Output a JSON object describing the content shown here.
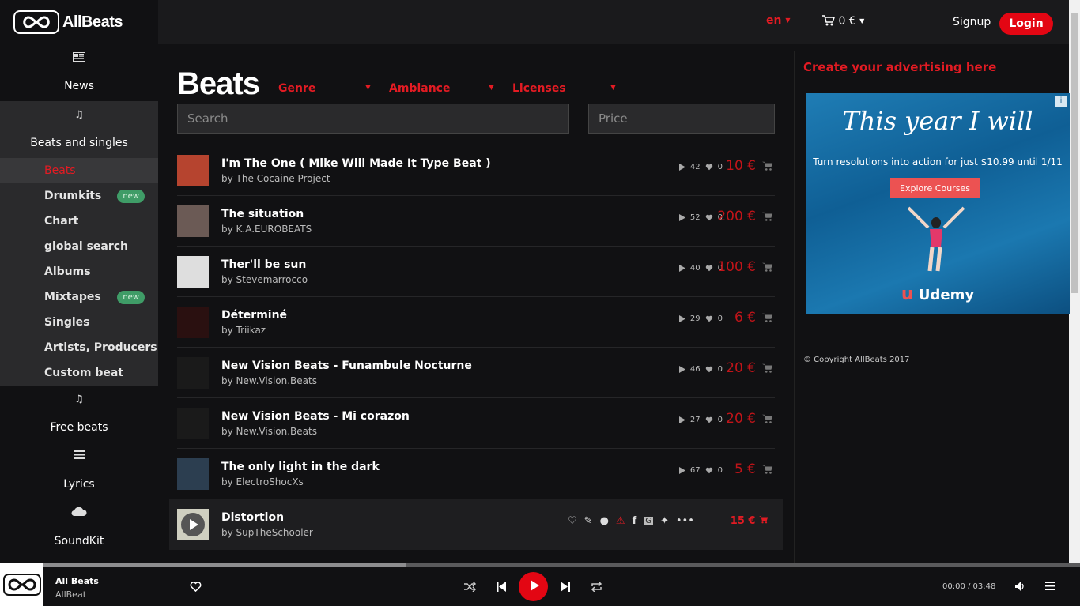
{
  "app": {
    "logo_text": "AllBeats"
  },
  "sidebar": {
    "news": "News",
    "beats_singles": "Beats and singles",
    "sub_items": [
      {
        "label": "Beats",
        "active": true,
        "badge": ""
      },
      {
        "label": "Drumkits",
        "badge": "new"
      },
      {
        "label": "Chart",
        "badge": ""
      },
      {
        "label": "global search",
        "badge": ""
      },
      {
        "label": "Albums",
        "badge": ""
      },
      {
        "label": "Mixtapes",
        "badge": "new"
      },
      {
        "label": "Singles",
        "badge": ""
      },
      {
        "label": "Artists, Producers",
        "badge": ""
      },
      {
        "label": "Custom beat",
        "badge": ""
      }
    ],
    "free_beats": "Free beats",
    "lyrics": "Lyrics",
    "soundkit": "SoundKit"
  },
  "topbar": {
    "lang": "en",
    "cart": "0 €",
    "signup": "Signup",
    "login": "Login"
  },
  "main": {
    "title": "Beats",
    "filters": [
      "Genre",
      "Ambiance",
      "Licenses"
    ],
    "search_placeholder": "Search",
    "price_placeholder": "Price",
    "tracks": [
      {
        "title": "I'm The One ( Mike Will Made It Type Beat )",
        "by": "by",
        "artist": "The Cocaine Project",
        "plays": "42",
        "likes": "0",
        "price": "10 €",
        "thumb": "#b6442f"
      },
      {
        "title": "The situation",
        "by": "by",
        "artist": "K.A.EUROBEATS",
        "plays": "52",
        "likes": "0",
        "price": "200 €",
        "thumb": "#6b5a55"
      },
      {
        "title": "Ther'll be sun",
        "by": "by",
        "artist": "Stevemarrocco",
        "plays": "40",
        "likes": "0",
        "price": "100 €",
        "thumb": "#dedede"
      },
      {
        "title": "Déterminé",
        "by": "by",
        "artist": "Triikaz",
        "plays": "29",
        "likes": "0",
        "price": "6 €",
        "thumb": "#2a1010"
      },
      {
        "title": "New Vision Beats - Funambule Nocturne",
        "by": "by",
        "artist": "New.Vision.Beats",
        "plays": "46",
        "likes": "0",
        "price": "20 €",
        "thumb": "#1a1a1a"
      },
      {
        "title": "New Vision Beats - Mi corazon",
        "by": "by",
        "artist": "New.Vision.Beats",
        "plays": "27",
        "likes": "0",
        "price": "20 €",
        "thumb": "#1a1a1a"
      },
      {
        "title": "The only light in the dark",
        "by": "by",
        "artist": "ElectroShocXs",
        "plays": "67",
        "likes": "0",
        "price": "5 €",
        "thumb": "#2c3e50"
      },
      {
        "title": "Distortion",
        "by": "by",
        "artist": "SupTheSchooler",
        "plays": "",
        "likes": "",
        "price": "15 €",
        "thumb": "#cfcfc0"
      }
    ]
  },
  "right": {
    "ad_link": "Create your advertising here",
    "ad": {
      "headline": "This year I will",
      "sub": "Turn resolutions into action for just $10.99 until 1/11",
      "button": "Explore Courses",
      "brand": "Udemy"
    },
    "copyright": "© Copyright AllBeats 2017"
  },
  "player": {
    "title": "All Beats",
    "artist": "AllBeat",
    "time": "00:00 / 03:48",
    "progress": 0.35
  },
  "colors": {
    "accent": "#e31b23",
    "bg": "#111113",
    "badge": "#3f9c67"
  }
}
